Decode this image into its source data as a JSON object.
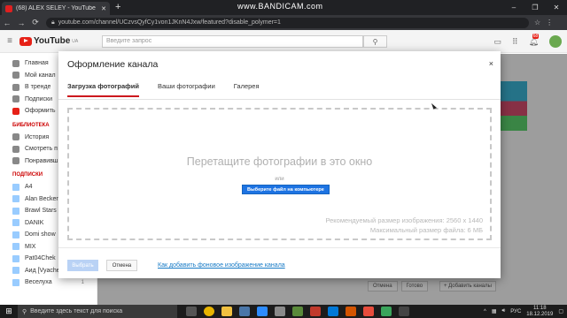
{
  "browser": {
    "tab_title": "(68) ALEX SELEY - YouTube",
    "new_tab": "+",
    "watermark": "www.BANDICAM.com",
    "url": "youtube.com/channel/UCzvsQyfCy1von1JKnN4Jxw/featured?disable_polymer=1",
    "window_controls": [
      "–",
      "❐",
      "✕"
    ]
  },
  "youtube": {
    "logo_text": "YouTube",
    "logo_region": "UA",
    "search_placeholder": "Введите запрос",
    "notification_count": "68"
  },
  "sidebar": {
    "main_items": [
      "Главная",
      "Мой канал",
      "В тренде",
      "Подписки",
      "Оформить"
    ],
    "library_heading": "БИБЛИОТЕКА",
    "library_items": [
      "История",
      "Смотреть п",
      "Понравивш"
    ],
    "subs_heading": "ПОДПИСКИ",
    "subscriptions": [
      {
        "name": "A4",
        "count": ""
      },
      {
        "name": "Alan Becker",
        "count": ""
      },
      {
        "name": "Brawl Stars",
        "count": ""
      },
      {
        "name": "DANIK",
        "count": ""
      },
      {
        "name": "Domi show",
        "count": ""
      },
      {
        "name": "MIX",
        "count": ""
      },
      {
        "name": "Pat04Chek",
        "count": ""
      },
      {
        "name": "Аид [VyachesIav",
        "count": "1"
      },
      {
        "name": "Веселуха",
        "count": "1"
      }
    ]
  },
  "background": {
    "cancel": "Отмена",
    "done": "Готово",
    "add_channels": "+ Добавить каналы"
  },
  "dialog": {
    "title": "Оформление канала",
    "close": "×",
    "tabs": [
      "Загрузка фотографий",
      "Ваши фотографии",
      "Галерея"
    ],
    "drop_text": "Перетащите фотографии в это окно",
    "or_text": "или",
    "choose_file": "Выберите файл на компьютере",
    "hint_size": "Рекомендуемый размер изображения: 2560 x 1440",
    "hint_max": "Максимальный размер файла: 6 МБ",
    "btn_choose": "Выбрать",
    "btn_cancel": "Отмена",
    "help_link": "Как добавить фоновое изображение канала"
  },
  "taskbar": {
    "search_placeholder": "Введите здесь текст для поиска",
    "lang": "РУС",
    "time": "11:18",
    "date": "18.12.2019"
  }
}
